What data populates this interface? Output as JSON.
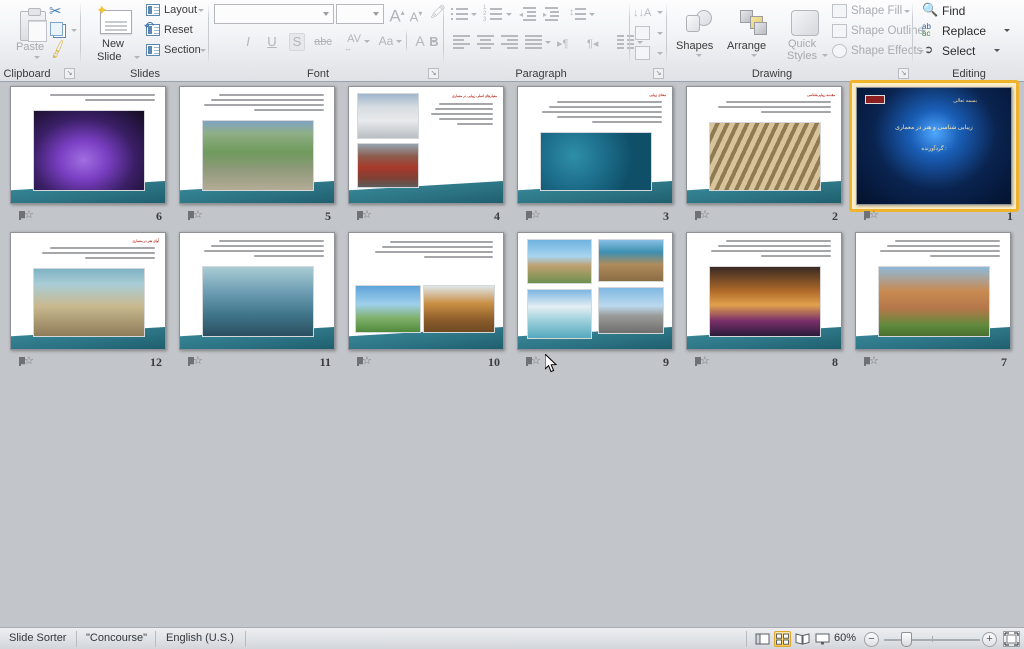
{
  "ribbon": {
    "groups": [
      {
        "name": "Clipboard",
        "title": "Clipboard"
      },
      {
        "name": "Slides",
        "title": "Slides"
      },
      {
        "name": "Font",
        "title": "Font"
      },
      {
        "name": "Paragraph",
        "title": "Paragraph"
      },
      {
        "name": "Drawing",
        "title": "Drawing"
      },
      {
        "name": "Editing",
        "title": "Editing"
      }
    ],
    "clipboard": {
      "paste_label": "Paste",
      "cut_icon": "scissors-icon",
      "copy_icon": "copy-icon",
      "format_painter_icon": "format-painter-icon",
      "dialog_launcher": "↘"
    },
    "slides": {
      "new_slide_label_1": "New",
      "new_slide_label_2": "Slide",
      "layout_label": "Layout",
      "reset_label": "Reset",
      "section_label": "Section"
    },
    "font": {
      "font_name_value": "",
      "font_name_placeholder": "",
      "font_size_value": "",
      "grow_font": "A",
      "shrink_font": "A",
      "clear_formatting_icon": "clear-formatting-icon",
      "bold": "B",
      "italic": "I",
      "underline": "U",
      "shadow": "S",
      "strikethrough": "abc",
      "character_spacing": "AV",
      "change_case": "Aa",
      "font_color": "A",
      "dialog_launcher": "↘"
    },
    "paragraph": {
      "bullets_icon": "bullets-icon",
      "numbering_icon": "numbering-icon",
      "decrease_indent_icon": "decrease-indent-icon",
      "increase_indent_icon": "increase-indent-icon",
      "line_spacing_icon": "line-spacing-icon",
      "text_direction_icon": "text-direction-icon",
      "align_left_icon": "align-left-icon",
      "center_icon": "align-center-icon",
      "align_right_icon": "align-right-icon",
      "justify_icon": "justify-icon",
      "ltr_icon": "left-to-right-icon",
      "rtl_icon": "right-to-left-icon",
      "columns_icon": "columns-icon",
      "align_text_icon": "align-text-icon",
      "convert_smartart_icon": "convert-to-smartart-icon",
      "dialog_launcher": "↘"
    },
    "drawing": {
      "shapes_label": "Shapes",
      "arrange_label": "Arrange",
      "quick_styles_label_1": "Quick",
      "quick_styles_label_2": "Styles",
      "shape_fill_label": "Shape Fill",
      "shape_outline_label": "Shape Outline",
      "shape_effects_label": "Shape Effects",
      "dialog_launcher": "↘"
    },
    "editing": {
      "find_label": "Find",
      "replace_label": "Replace",
      "select_label": "Select"
    }
  },
  "workspace": {
    "rows": [
      {
        "slides": [
          {
            "number": "6",
            "selected": false,
            "layout": "text-top-image-bottom",
            "title": "",
            "photo": "ph-purple",
            "text_lines": 2,
            "caption": ""
          },
          {
            "number": "5",
            "selected": false,
            "layout": "text-top-image-bottom",
            "title": "",
            "photo": "ph-green",
            "text_lines": 4,
            "caption": ""
          },
          {
            "number": "4",
            "selected": false,
            "layout": "two-image-left-text-right",
            "title": "معیارهای اصلی زیبایی در معماری",
            "photo": "ph-museum",
            "photo2": "ph-brick",
            "text_lines": 5,
            "caption": ""
          },
          {
            "number": "3",
            "selected": false,
            "layout": "text-top-image-bottom",
            "title": "معنای زیبایی",
            "photo": "ph-tile",
            "text_lines": 5,
            "caption": ""
          },
          {
            "number": "2",
            "selected": false,
            "layout": "text-top-image-bottom",
            "title": "مقدمه زیبایی‌شناسی",
            "photo": "ph-wood",
            "text_lines": 3,
            "caption": ""
          },
          {
            "number": "1",
            "selected": true,
            "layout": "title-slide",
            "title": "بسمه تعالی",
            "heading": "زیبایی شناسی و هنر در معماری",
            "subheading": "گردآورنده :",
            "photo": "ph-night",
            "text_lines": 0,
            "caption": ""
          }
        ]
      },
      {
        "slides": [
          {
            "number": "12",
            "selected": false,
            "layout": "text-top-image-bottom",
            "title": "آوای هنر در معماری",
            "photo": "ph-arch",
            "text_lines": 3,
            "caption": ""
          },
          {
            "number": "11",
            "selected": false,
            "layout": "text-top-image-bottom",
            "title": "",
            "photo": "ph-blue-room",
            "text_lines": 4,
            "caption": ""
          },
          {
            "number": "10",
            "selected": false,
            "layout": "text-top-two-images",
            "title": "",
            "photo": "ph-towers",
            "photo2": "ph-pyramid",
            "text_lines": 4,
            "caption": ""
          },
          {
            "number": "9",
            "selected": false,
            "layout": "four-image-grid",
            "title": "",
            "photo": "ph-dome",
            "photo2": "ph-dome2",
            "photo3": "ph-opera",
            "photo4": "ph-bridge",
            "text_lines": 0,
            "caption": "",
            "has_cursor": true
          },
          {
            "number": "8",
            "selected": false,
            "layout": "text-top-image-bottom",
            "title": "",
            "photo": "ph-pool",
            "text_lines": 4,
            "caption": ""
          },
          {
            "number": "7",
            "selected": false,
            "layout": "text-top-image-bottom",
            "title": "",
            "photo": "ph-courtyard",
            "text_lines": 4,
            "caption": ""
          }
        ]
      }
    ],
    "transition_icon": "transition-star-icon"
  },
  "status_bar": {
    "view_name": "Slide Sorter",
    "theme_name": "\"Concourse\"",
    "language": "English (U.S.)",
    "zoom_level": "60%",
    "zoom_out_label": "−",
    "zoom_in_label": "+",
    "views": [
      {
        "name": "normal-view",
        "active": false
      },
      {
        "name": "slide-sorter-view",
        "active": true
      },
      {
        "name": "reading-view",
        "active": false
      },
      {
        "name": "slide-show-view",
        "active": false
      }
    ],
    "fit_button": "fit-slide-to-window-icon"
  }
}
